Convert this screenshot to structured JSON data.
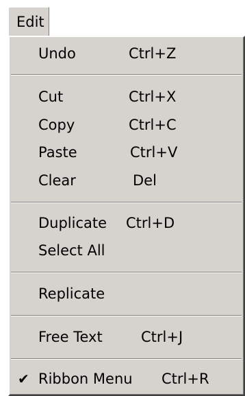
{
  "menubar": {
    "title": "Edit"
  },
  "menu": {
    "undo": {
      "label": "Undo",
      "shortcut": "Ctrl+Z"
    },
    "cut": {
      "label": "Cut",
      "shortcut": "Ctrl+X"
    },
    "copy": {
      "label": "Copy",
      "shortcut": "Ctrl+C"
    },
    "paste": {
      "label": "Paste",
      "shortcut": "Ctrl+V"
    },
    "clear": {
      "label": "Clear",
      "shortcut": "Del"
    },
    "duplicate": {
      "label": "Duplicate",
      "shortcut": "Ctrl+D"
    },
    "select_all": {
      "label": "Select All"
    },
    "replicate": {
      "label": "Replicate"
    },
    "free_text": {
      "label": "Free Text",
      "shortcut": "Ctrl+J"
    },
    "ribbon_menu": {
      "label": "Ribbon Menu",
      "shortcut": "Ctrl+R",
      "checked": true,
      "check_glyph": "✔"
    }
  },
  "colors": {
    "menu_face": "#d6d3ce",
    "highlight": "#ffffff",
    "shadow": "#808080",
    "dark_shadow": "#404040"
  }
}
